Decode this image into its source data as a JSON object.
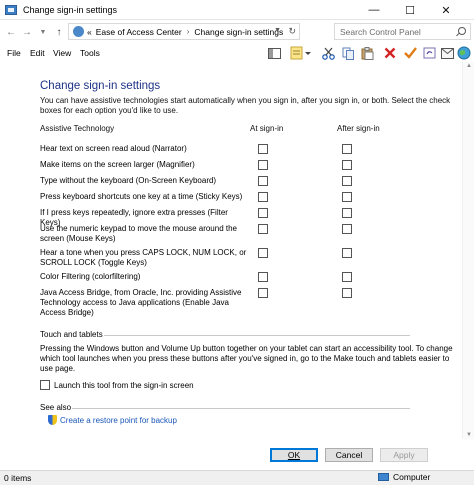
{
  "window": {
    "title": "Change sign-in settings",
    "minimize": "—",
    "maximize": "☐",
    "close": "✕"
  },
  "address": {
    "crumb1": "Ease of Access Center",
    "sep": "›",
    "crumb0": "«",
    "crumb2": "Change sign-in settings"
  },
  "search": {
    "placeholder": "Search Control Panel"
  },
  "menu": {
    "file": "File",
    "edit": "Edit",
    "view": "View",
    "tools": "Tools"
  },
  "page": {
    "title": "Change sign-in settings",
    "intro": "You can have assistive technologies start automatically when you sign in, after you sign in, or both. Select the check boxes for each option you'd like to use.",
    "col_tech": "Assistive Technology",
    "col_at": "At sign-in",
    "col_after": "After sign-in",
    "rows": [
      "Hear text on screen read aloud (Narrator)",
      "Make items on the screen larger (Magnifier)",
      "Type without the keyboard (On-Screen Keyboard)",
      "Press keyboard shortcuts one key at a time (Sticky Keys)",
      "If I press keys repeatedly, ignore extra presses (Filter Keys)",
      "Use the numeric keypad to move the mouse around the screen (Mouse Keys)",
      "Hear a tone when you press CAPS LOCK, NUM LOCK, or SCROLL LOCK (Toggle Keys)",
      "Color Filtering (colorfiltering)",
      "Java Access Bridge, from Oracle, Inc. providing Assistive Technology access to Java applications (Enable Java Access Bridge)"
    ],
    "touch_title": "Touch and tablets",
    "touch_text": "Pressing the Windows button and Volume Up button together on your tablet can start an accessibility tool. To change which tool launches when you press these buttons after you've signed in, go to the Make touch and tablets easier to use page.",
    "launch_label": "Launch this tool from the sign-in screen",
    "see_also": "See also",
    "restore_link": "Create a restore point for backup"
  },
  "buttons": {
    "ok": "OK",
    "cancel": "Cancel",
    "apply": "Apply"
  },
  "status": {
    "count": "0 items",
    "location": "Computer"
  },
  "icons": {
    "toolbar": [
      "pane-icon",
      "note-icon",
      "cut-icon",
      "copy-icon",
      "paste-icon",
      "delete-icon",
      "checkmark-icon",
      "undo-icon",
      "mail-icon",
      "globe-icon"
    ]
  }
}
